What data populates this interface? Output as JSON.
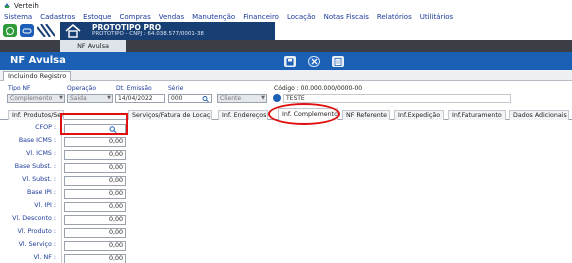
{
  "window": {
    "title": "Verteih"
  },
  "menu": [
    "Sistema",
    "Cadastros",
    "Estoque",
    "Compras",
    "Vendas",
    "Manutenção",
    "Financeiro",
    "Locação",
    "Notas Fiscais",
    "Relatórios",
    "Utilitários"
  ],
  "banner": {
    "title": "PROTOTIPO PRO",
    "subtitle": "PROTOTIPO - CNPJ : 64.038.577/0001-38"
  },
  "open_tab": "NF Avulsa",
  "header": {
    "title": "NF Avulsa"
  },
  "subtab": "Incluindo Registro",
  "form": {
    "tipo_nf": {
      "label": "Tipo NF",
      "value": "Complemento"
    },
    "operacao": {
      "label": "Operação",
      "value": "Saída"
    },
    "dt_emissao": {
      "label": "Dt. Emissão",
      "value": "14/04/2022"
    },
    "serie": {
      "label": "Série",
      "value": "000"
    },
    "cliente": {
      "value": "Cliente"
    },
    "codigo": {
      "label": "Código : 00.000.000/0000-00",
      "value": "TESTE"
    }
  },
  "tabs": [
    "Inf. Produtos/Ser",
    "Serviços/Fatura de Locação",
    "Inf. Endereços",
    "Inf. Complemento",
    "NF Referente",
    "Inf.Expedição",
    "Inf.Faturamento",
    "Dados Adicionais"
  ],
  "active_tab": 3,
  "fields": [
    {
      "label": "CFOP :",
      "value": ""
    },
    {
      "label": "Base ICMS :",
      "value": "0,00"
    },
    {
      "label": "Vl. ICMS :",
      "value": "0,00"
    },
    {
      "label": "Base Subst. :",
      "value": "0,00"
    },
    {
      "label": "Vl. Subst. :",
      "value": "0,00"
    },
    {
      "label": "Base IPI :",
      "value": "0,00"
    },
    {
      "label": "Vl. IPI :",
      "value": "0,00"
    },
    {
      "label": "Vl. Desconto :",
      "value": "0,00"
    },
    {
      "label": "Vl. Produto :",
      "value": "0,00"
    },
    {
      "label": "Vl. Serviço :",
      "value": "0,00"
    },
    {
      "label": "Vl. NF :",
      "value": "0,00"
    }
  ],
  "colors": {
    "header_blue": "#1c60b6",
    "banner": "#173f73",
    "highlight": "#e01010",
    "label_blue": "#1a3a9a"
  }
}
